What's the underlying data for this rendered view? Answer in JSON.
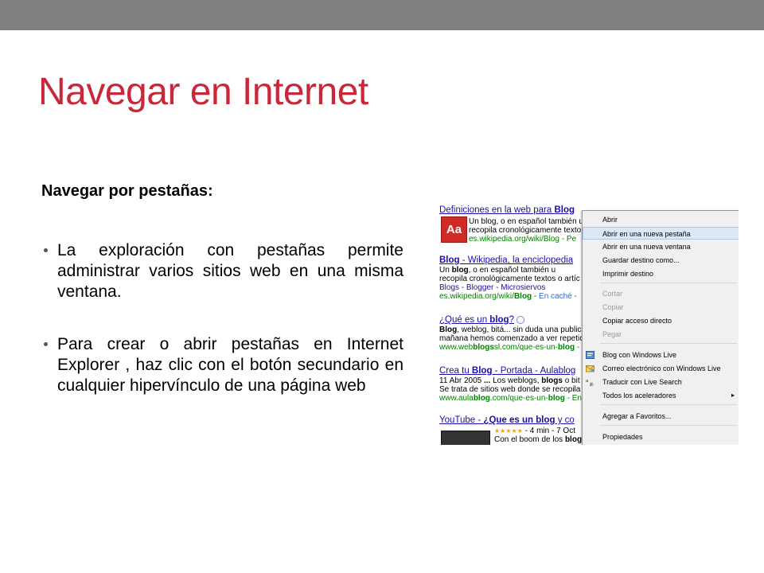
{
  "slide": {
    "title": "Navegar en Internet",
    "subtitle": "Navegar por pestañas:",
    "bullets": [
      "La exploración con pestañas permite administrar varios sitios web en una misma ventana.",
      "Para crear o abrir pestañas en Internet Explorer , haz clic con el botón secundario en cualquier hipervínculo de una página web"
    ],
    "accent_color": "#c8283a",
    "topbar_color": "#7f7f7f"
  },
  "screenshot": {
    "results": [
      {
        "title_pre": "Definiciones en la web para ",
        "title_bold": "Blog",
        "lines": [
          "Un blog, o en español también u",
          "recopila cronológicamente texto"
        ],
        "url_pre": "es.wikipedia.org/wiki/Blog",
        "url_post": " - Pe",
        "logo": "Aa"
      },
      {
        "title_bold": "Blog",
        "title_post": " - Wikipedia, la enciclopedia",
        "line_pre": "Un ",
        "line_bold": "blog",
        "line_post": ", o en español también u",
        "line2": "recopila cronológicamente textos o artíc",
        "links": "Blogs - Blogger - Microsiervos",
        "url_pre": "es.wikipedia.org/wiki/",
        "url_bold": "Blog",
        "url_sep": " - ",
        "url_cache": "En caché",
        "url_post": " -"
      },
      {
        "title_pre": "¿Qué es un ",
        "title_bold": "blog",
        "title_post": "?",
        "line_bold": "Blog",
        "line_post": ", weblog, bitá... sin duda una publica",
        "line2": "mañana hemos comenzado a ver repetic",
        "url_pre": "www.web",
        "url_bold": "blogs",
        "url_mid": "sl.com/que-es-un-",
        "url_bold2": "blog",
        "url_post": " - E"
      },
      {
        "title_pre": "Crea tu ",
        "title_bold": "Blog",
        "title_post": " - Portada - Aulablog",
        "line_pre": "11 Abr 2005 ",
        "line_bold": "...",
        "line_mid": " Los weblogs, ",
        "line_bold2": "blogs",
        "line_post": " o bit",
        "line2": "Se trata de sitios web donde se recopila",
        "url_pre": "www.aula",
        "url_bold": "blog",
        "url_mid": ".com/que-es-un-",
        "url_bold2": "blog",
        "url_post": " - En"
      },
      {
        "title_pre": "YouTube - ",
        "title_bold": "¿Que es un blog",
        "title_post": " y co",
        "rating": "★★★★★",
        "meta": " - 4 min - 7 Oct",
        "line_pre": "Con el boom de los ",
        "line_bold": "blog"
      }
    ],
    "menu": [
      {
        "label": "Abrir",
        "state": "normal"
      },
      {
        "label": "Abrir en una nueva pestaña",
        "state": "highlighted"
      },
      {
        "label": "Abrir en una nueva ventana",
        "state": "normal"
      },
      {
        "label": "Guardar destino como...",
        "state": "normal"
      },
      {
        "label": "Imprimir destino",
        "state": "normal"
      },
      {
        "label": "Cortar",
        "state": "disabled"
      },
      {
        "label": "Copiar",
        "state": "disabled"
      },
      {
        "label": "Copiar acceso directo",
        "state": "normal"
      },
      {
        "label": "Pegar",
        "state": "disabled"
      },
      {
        "label": "Blog con Windows Live",
        "state": "normal",
        "icon": "blog-icon"
      },
      {
        "label": "Correo electrónico con Windows Live",
        "state": "normal",
        "icon": "mail-icon"
      },
      {
        "label": "Traducir con Live Search",
        "state": "normal",
        "icon": "translate-icon"
      },
      {
        "label": "Todos los aceleradores",
        "state": "normal",
        "submenu": "▸"
      },
      {
        "label": "Agregar a Favoritos...",
        "state": "normal"
      },
      {
        "label": "Propiedades",
        "state": "normal"
      }
    ]
  }
}
